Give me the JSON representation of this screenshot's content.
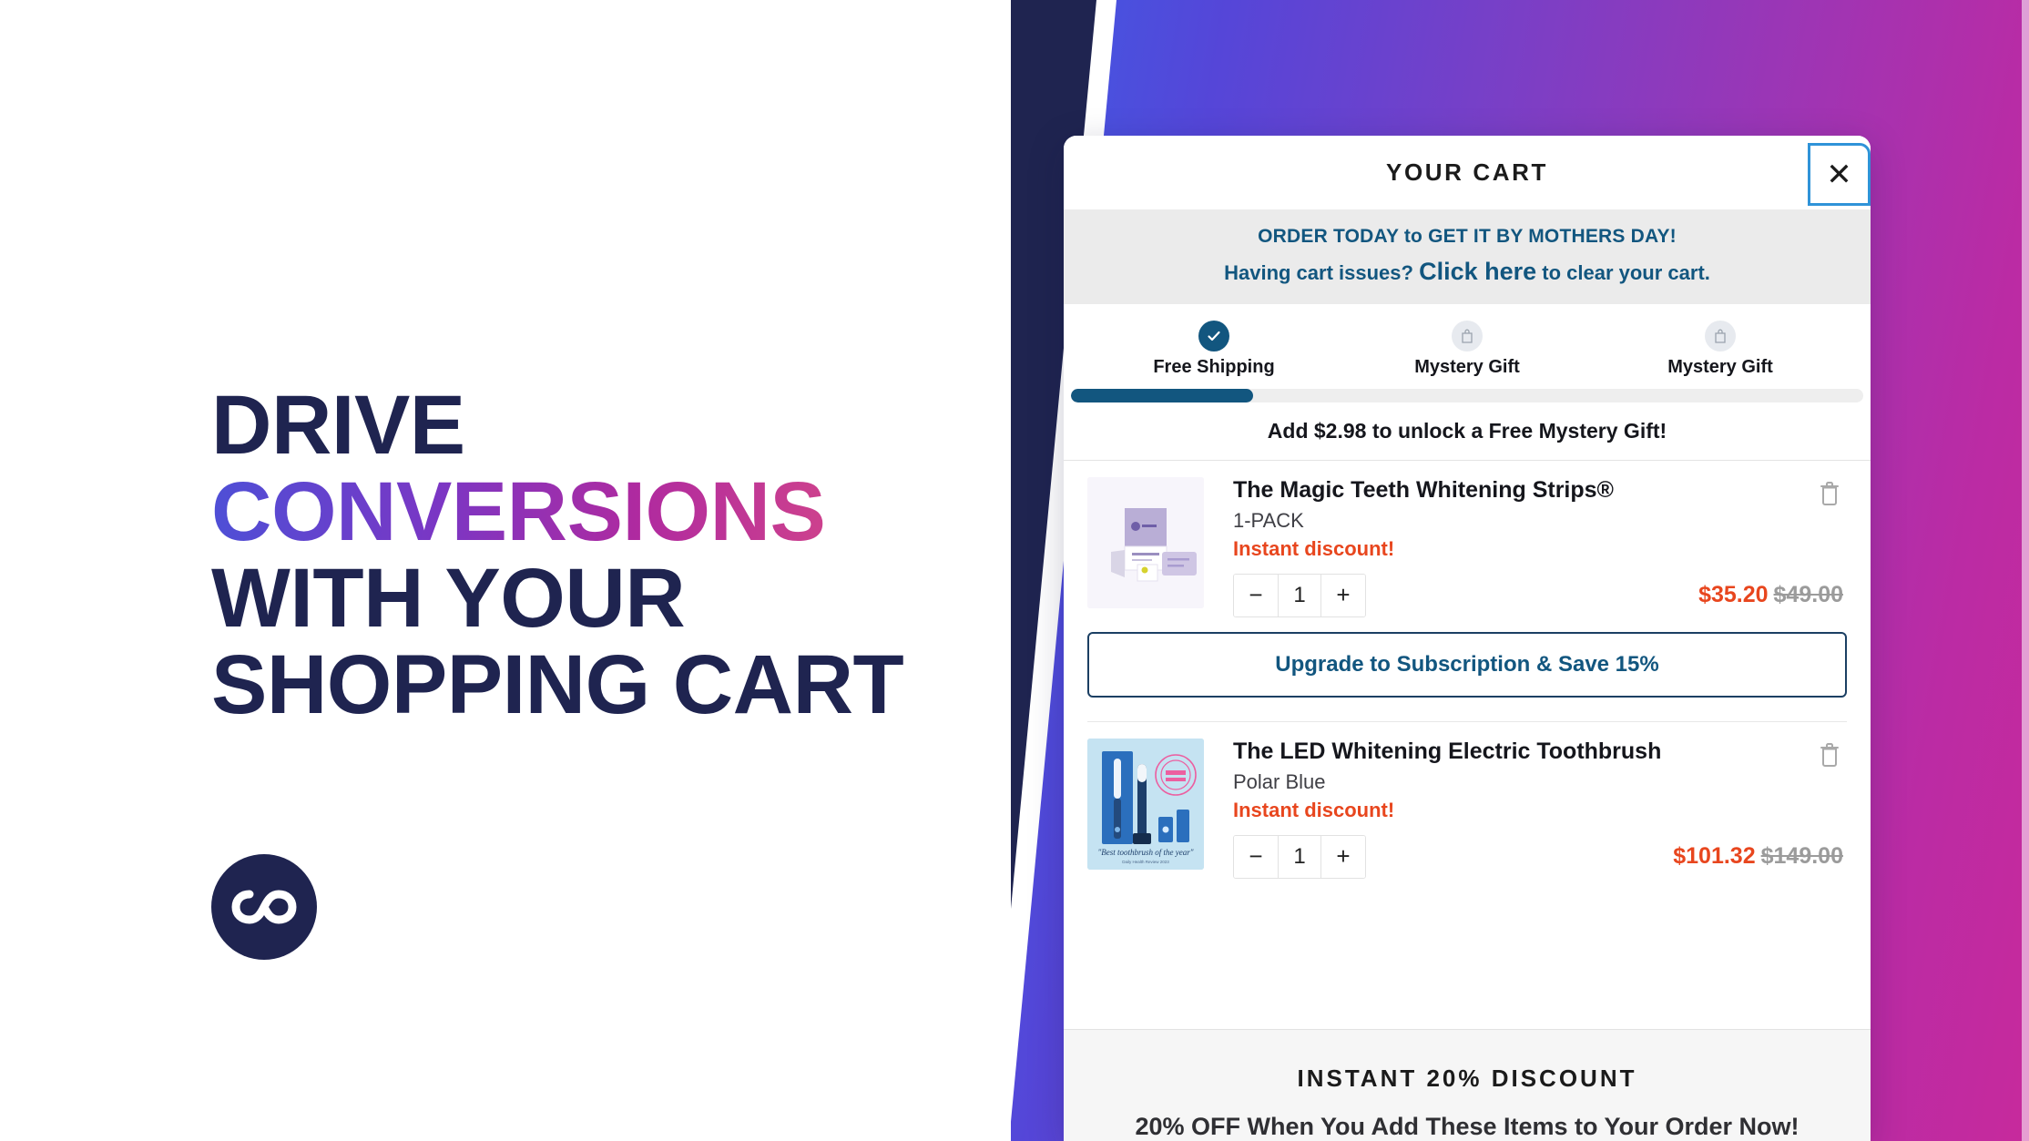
{
  "hero": {
    "headline_lines": [
      "DRIVE",
      "CONVERSIONS",
      "WITH YOUR",
      "SHOPPING CART"
    ],
    "gradient_line_index": 1,
    "logo_name": "infinity-logo",
    "navy": "#1f2450",
    "gradient_from": "#3f5be4",
    "gradient_to": "#c72a9c"
  },
  "cart": {
    "title": "YOUR CART",
    "close_label": "✕",
    "announcement": {
      "line1": "ORDER TODAY to GET IT BY MOTHERS DAY!",
      "line2_prefix": "Having cart issues? ",
      "line2_link": "Click here",
      "line2_suffix": " to clear your cart."
    },
    "rewards": {
      "tiers": [
        {
          "label": "Free Shipping",
          "state": "unlocked",
          "icon": "check-icon"
        },
        {
          "label": "Mystery Gift",
          "state": "locked",
          "icon": "gift-bag-icon"
        },
        {
          "label": "Mystery Gift",
          "state": "locked",
          "icon": "gift-bag-icon"
        }
      ],
      "progress_percent": 23,
      "unlock_message": "Add $2.98 to unlock a Free Mystery Gift!"
    },
    "items": [
      {
        "title": "The Magic Teeth Whitening Strips®",
        "variant": "1-PACK",
        "promo": "Instant discount!",
        "quantity": "1",
        "price_now": "$35.20",
        "price_was": "$49.00",
        "minus": "−",
        "plus": "+",
        "thumb": "magic-teeth-whitening-strips-box",
        "upgrade_label": "Upgrade to Subscription & Save 15%"
      },
      {
        "title": "The LED Whitening Electric Toothbrush",
        "variant": "Polar Blue",
        "promo": "Instant discount!",
        "quantity": "1",
        "price_now": "$101.32",
        "price_was": "$149.00",
        "minus": "−",
        "plus": "+",
        "thumb": "led-whitening-electric-toothbrush-box",
        "thumb_caption": "\"Best toothbrush of the year\""
      }
    ],
    "upsell": {
      "heading": "INSTANT 20% DISCOUNT",
      "subheading": "20% OFF When You Add These Items to Your Order Now!"
    },
    "colors": {
      "brand_blue": "#12567f",
      "accent_orange": "#e8461e",
      "close_border": "#2f93d8"
    }
  }
}
